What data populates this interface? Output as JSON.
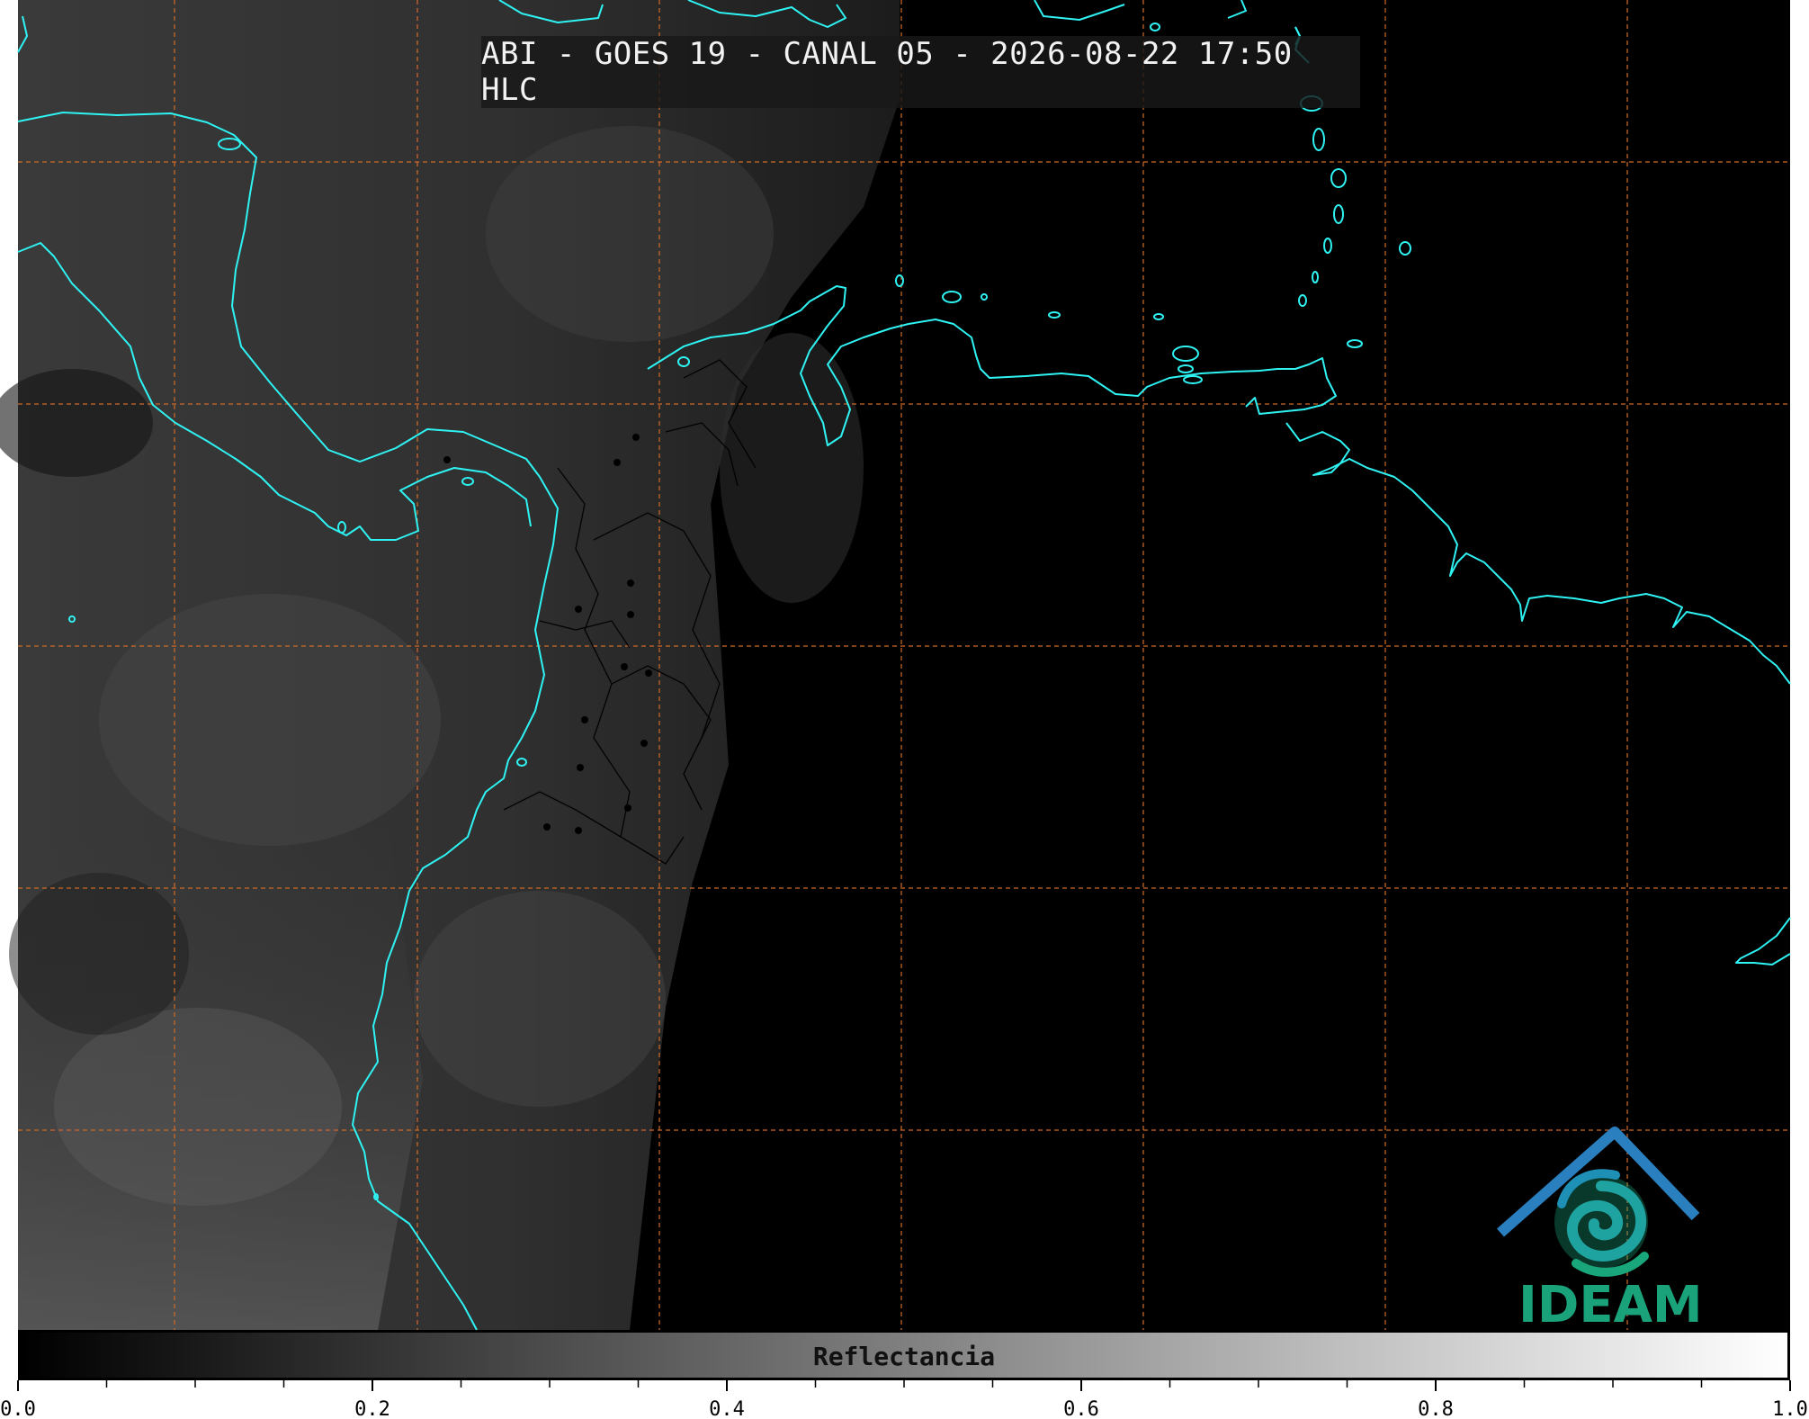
{
  "title": "ABI - GOES 19 - CANAL 05 - 2026-08-22 17:50 HLC",
  "colorbar": {
    "label": "Reflectancia",
    "min": 0.0,
    "max": 1.0,
    "tick_labels": [
      "0.0",
      "0.2",
      "0.4",
      "0.6",
      "0.8",
      "1.0"
    ],
    "minor_tick_step": 0.05
  },
  "logo": {
    "text": "IDEAM",
    "color": "#1aa37a"
  },
  "colors": {
    "coastline": "#2ff3f3",
    "grid": "#d06a28",
    "borders": "#000000",
    "night_side": "#000000",
    "day_side": "#2a2a2a"
  }
}
